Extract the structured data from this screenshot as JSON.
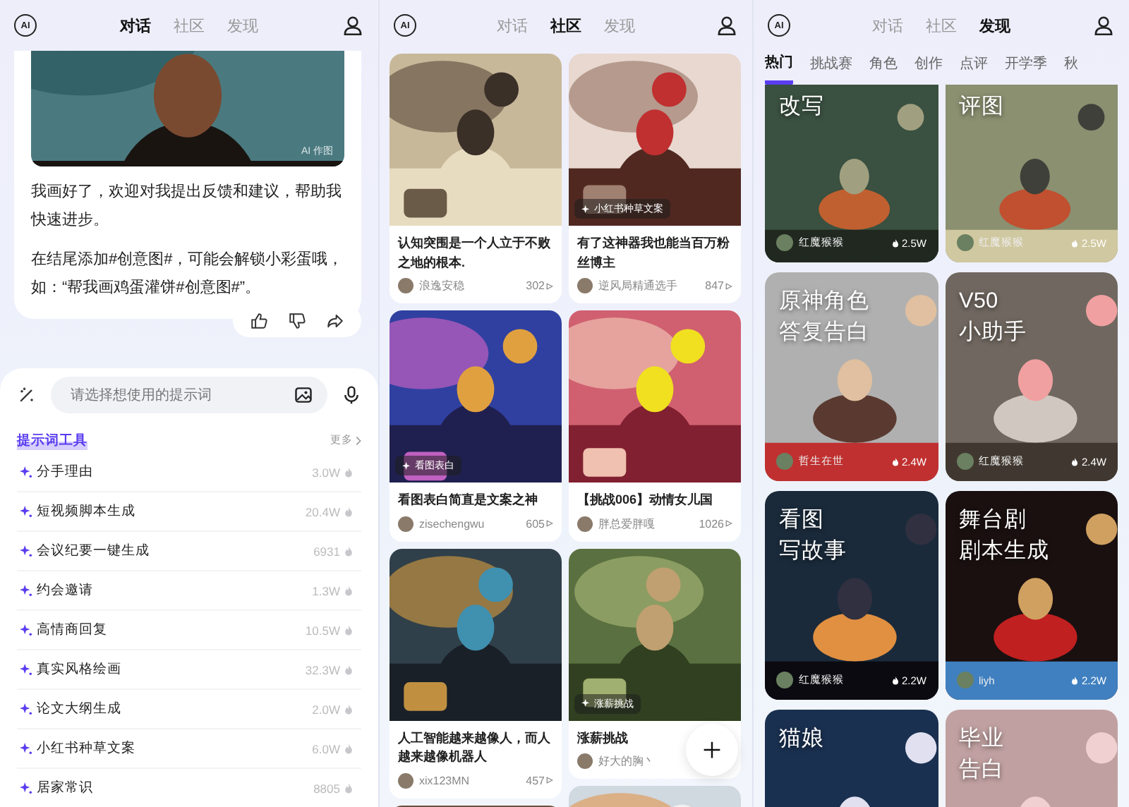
{
  "chat_screen": {
    "logo": "AI",
    "tabs": [
      {
        "label": "对话",
        "selected": true
      },
      {
        "label": "社区",
        "selected": false
      },
      {
        "label": "发现",
        "selected": false
      }
    ],
    "image_label": "AI 作图",
    "messages": [
      "我画好了，欢迎对我提出反馈和建议，帮助我快速进步。",
      "在结尾添加#创意图#，可能会解锁小彩蛋哦，如：“帮我画鸡蛋灌饼#创意图#”。"
    ],
    "input": {
      "placeholder": "请选择想使用的提示词"
    },
    "prompt_tools": {
      "title": "提示词工具",
      "more": "更多",
      "items": [
        {
          "name": "分手理由",
          "count": "3.0W"
        },
        {
          "name": "短视频脚本生成",
          "count": "20.4W"
        },
        {
          "name": "会议纪要一键生成",
          "count": "6931"
        },
        {
          "name": "约会邀请",
          "count": "1.3W"
        },
        {
          "name": "高情商回复",
          "count": "10.5W"
        },
        {
          "name": "真实风格绘画",
          "count": "32.3W"
        },
        {
          "name": "论文大纲生成",
          "count": "2.0W"
        },
        {
          "name": "小红书种草文案",
          "count": "6.0W"
        },
        {
          "name": "居家常识",
          "count": "8805"
        }
      ]
    }
  },
  "community_screen": {
    "logo": "AI",
    "tabs": [
      {
        "label": "对话",
        "selected": false
      },
      {
        "label": "社区",
        "selected": true
      },
      {
        "label": "发现",
        "selected": false
      }
    ],
    "columns": [
      [
        {
          "kind": "post",
          "title": "认知突围是一个人立于不败之地的根本.",
          "author": "浪逸安稳",
          "views": "302"
        },
        {
          "kind": "post",
          "tag": "看图表白",
          "title": "看图表白简直是文案之神",
          "author": "zisechengwu",
          "views": "605"
        },
        {
          "kind": "post",
          "title": "人工智能越来越像人，而人越来越像机器人",
          "author": "xix123MN",
          "views": "457"
        },
        {
          "kind": "picture"
        }
      ],
      [
        {
          "kind": "post",
          "tag": "小红书种草文案",
          "title": "有了这神器我也能当百万粉丝博主",
          "author": "逆风局精通选手",
          "views": "847"
        },
        {
          "kind": "post",
          "title": "【挑战006】动情女儿国",
          "author": "胖总爱胖嘎",
          "views": "1026"
        },
        {
          "kind": "post",
          "tag": "涨薪挑战",
          "title": "涨薪挑战",
          "author": "好大的胸丶"
        },
        {
          "kind": "picture"
        }
      ]
    ]
  },
  "discover_screen": {
    "logo": "AI",
    "tabs": [
      {
        "label": "对话",
        "selected": false
      },
      {
        "label": "社区",
        "selected": false
      },
      {
        "label": "发现",
        "selected": true
      }
    ],
    "categories": [
      {
        "label": "热门",
        "selected": true
      },
      {
        "label": "挑战赛",
        "selected": false
      },
      {
        "label": "角色",
        "selected": false
      },
      {
        "label": "创作",
        "selected": false
      },
      {
        "label": "点评",
        "selected": false
      },
      {
        "label": "开学季",
        "selected": false
      },
      {
        "label": "秋",
        "selected": false
      }
    ],
    "cards": [
      {
        "title_lines": [
          "改写"
        ],
        "author": "红魔猴猴",
        "likes": "2.5W"
      },
      {
        "title_lines": [
          "评图"
        ],
        "author": "红魔猴猴",
        "likes": "2.5W"
      },
      {
        "title_lines": [
          "原神角色",
          "答复告白"
        ],
        "author": "哲生在世",
        "likes": "2.4W"
      },
      {
        "title_lines": [
          "V50",
          "小助手"
        ],
        "author": "红魔猴猴",
        "likes": "2.4W"
      },
      {
        "title_lines": [
          "看图",
          "写故事"
        ],
        "author": "红魔猴猴",
        "likes": "2.2W"
      },
      {
        "title_lines": [
          "舞台剧",
          "剧本生成"
        ],
        "author": "liyh",
        "likes": "2.2W"
      },
      {
        "title_lines": [
          "猫娘"
        ]
      },
      {
        "title_lines": [
          "毕业",
          "告白"
        ]
      }
    ]
  }
}
